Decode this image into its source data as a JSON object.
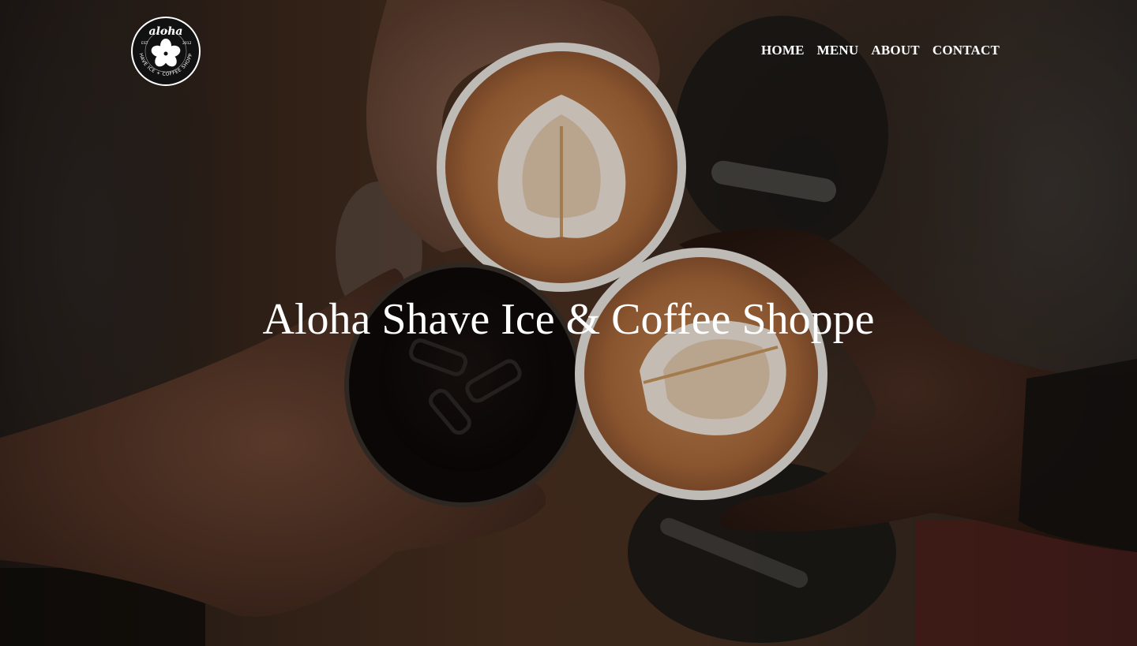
{
  "brand": {
    "logo_wordmark": "aloha",
    "logo_ring_text": "SHAVE ICE + COFFEE SHOPPE",
    "logo_est": "EST",
    "logo_year": "2012"
  },
  "nav": {
    "items": [
      {
        "label": "HOME"
      },
      {
        "label": "MENU"
      },
      {
        "label": "ABOUT"
      },
      {
        "label": "CONTACT"
      }
    ]
  },
  "hero": {
    "title": "Aloha Shave Ice & Coffee Shoppe",
    "background_description_icon": "coffee-cheers-photo"
  },
  "colors": {
    "text": "#ffffff",
    "logo_bg": "#111111",
    "foam": "#efe6da",
    "crema": "#b97a45",
    "table": "#4a3020"
  }
}
